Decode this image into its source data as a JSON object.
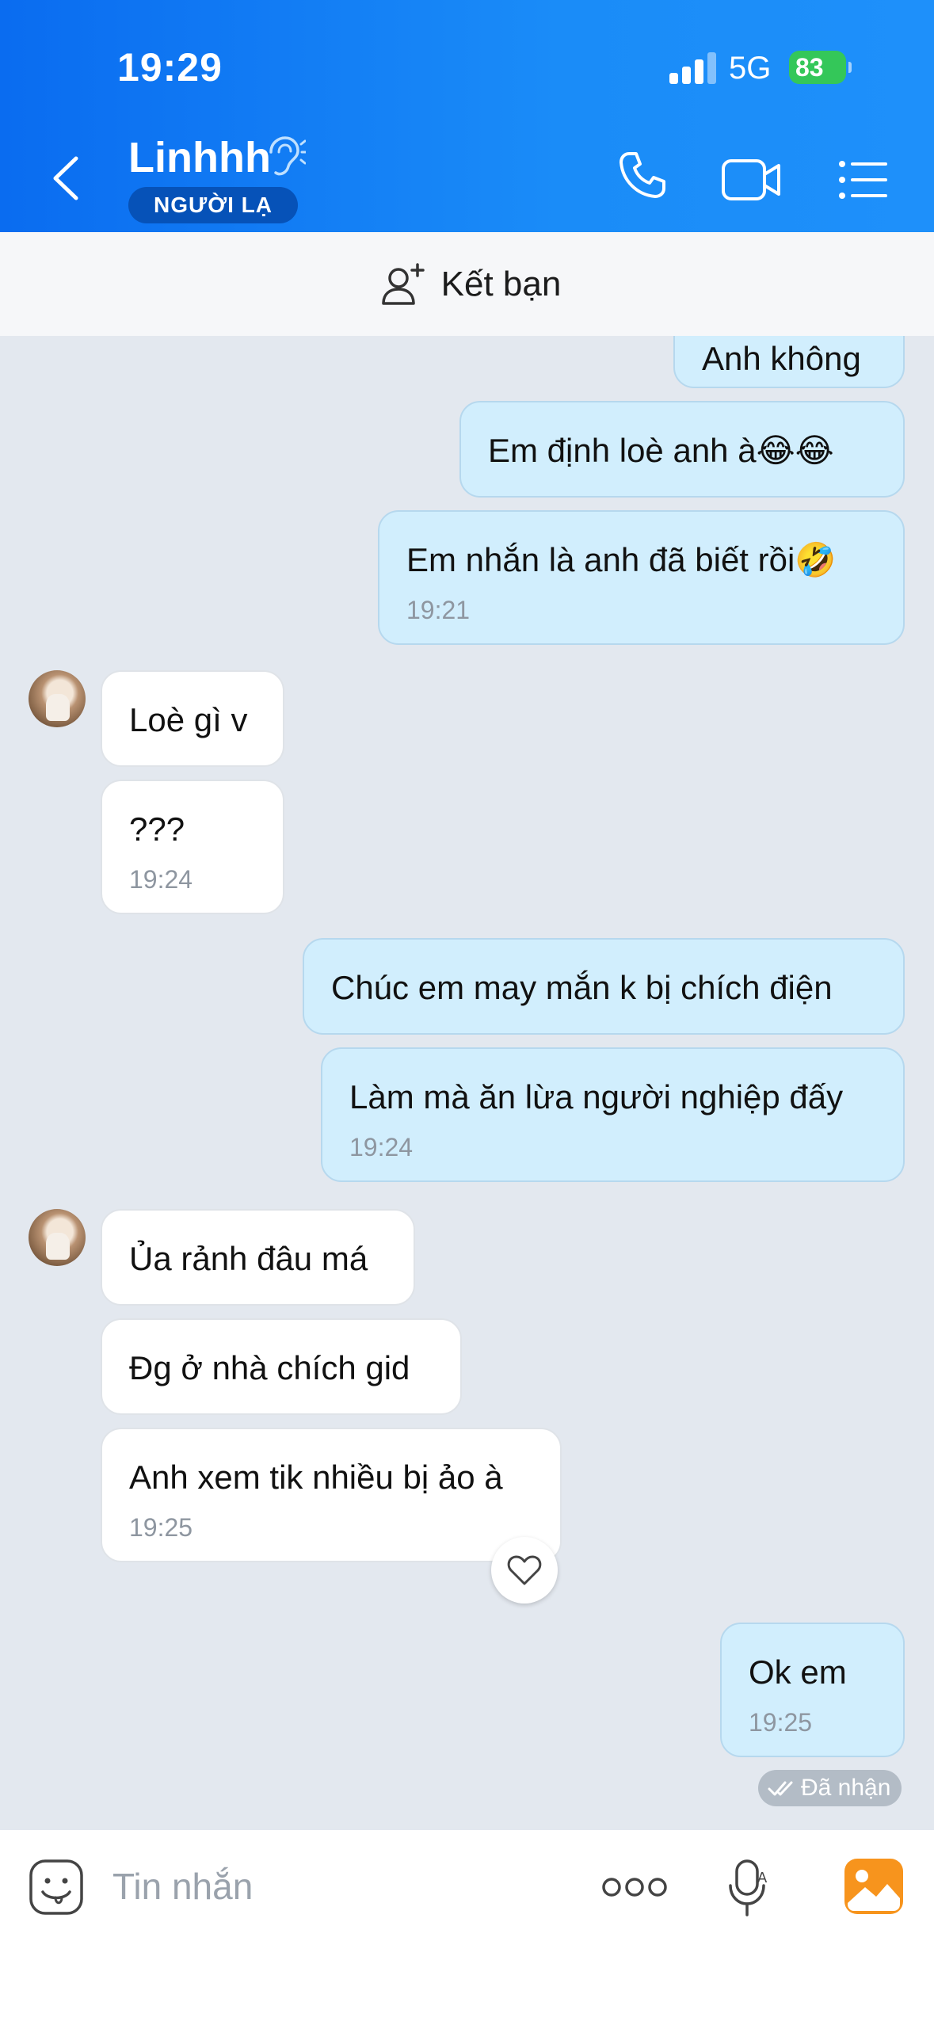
{
  "status_bar": {
    "time": "19:29",
    "network": "5G",
    "battery": "83"
  },
  "header": {
    "contact_name": "Linhhh",
    "badge": "NGƯỜI LẠ"
  },
  "add_friend": {
    "label": "Kết bạn"
  },
  "messages": [
    {
      "side": "out",
      "text": "Anh không"
    },
    {
      "side": "out",
      "text": "Em định loè anh à😂😂"
    },
    {
      "side": "out",
      "text": "Em nhắn là anh đã biết rồi🤣",
      "time": "19:21"
    },
    {
      "side": "in",
      "text": "Loè gì v"
    },
    {
      "side": "in",
      "text": "???",
      "time": "19:24"
    },
    {
      "side": "out",
      "text": "Chúc em may mắn k bị chích điện"
    },
    {
      "side": "out",
      "text": "Làm mà ăn lừa người nghiệp đấy",
      "time": "19:24"
    },
    {
      "side": "in",
      "text": "Ủa rảnh đâu má"
    },
    {
      "side": "in",
      "text": "Đg ở nhà chích gid"
    },
    {
      "side": "in",
      "text": "Anh xem tik nhiều bị ảo à",
      "time": "19:25"
    },
    {
      "side": "out",
      "text": "Ok em",
      "time": "19:25"
    }
  ],
  "delivery_status": "Đã nhận",
  "composer": {
    "placeholder": "Tin nhắn"
  },
  "colors": {
    "header_blue": "#1a8cf8",
    "outgoing_bubble": "#d1eefd",
    "incoming_bubble": "#ffffff",
    "chat_bg": "#e3e8ef",
    "battery_green": "#34c759"
  }
}
